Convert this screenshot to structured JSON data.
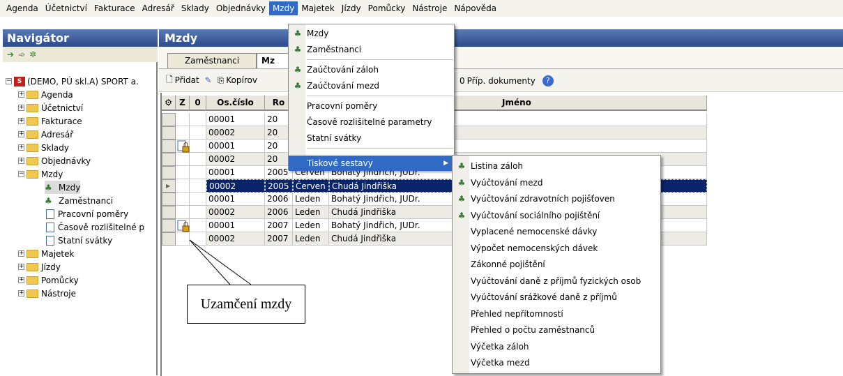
{
  "menubar": {
    "items": [
      "Agenda",
      "Účetnictví",
      "Fakturace",
      "Adresář",
      "Sklady",
      "Objednávky",
      "Mzdy",
      "Majetek",
      "Jízdy",
      "Pomůcky",
      "Nástroje",
      "Nápověda"
    ],
    "active": "Mzdy"
  },
  "navigator": {
    "title": "Navigátor",
    "tree": {
      "root": "(DEMO, PÚ skl.A) SPORT a.",
      "folders": [
        "Agenda",
        "Účetnictví",
        "Fakturace",
        "Adresář",
        "Sklady",
        "Objednávky",
        "Mzdy"
      ],
      "mzdy_children": [
        "Mzdy",
        "Zaměstnanci",
        "Pracovní poměry",
        "Časově rozlišitelné p",
        "Statní svátky"
      ],
      "after": [
        "Majetek",
        "Jízdy",
        "Pomůcky",
        "Nástroje"
      ]
    }
  },
  "main": {
    "title": "Mzdy",
    "tabs": [
      "Zaměstnanci",
      "Mz"
    ],
    "toolbar": {
      "add": "Přidat",
      "copy": "Kopírov",
      "attachments": "Příp. dokumenty"
    }
  },
  "grid": {
    "headers": {
      "z": "Z",
      "att": "0",
      "os": "Os.číslo",
      "ro": "Ro",
      "jmeno": "Jméno"
    },
    "rows": [
      {
        "os": "00001",
        "year": "20",
        "month": "",
        "name": ""
      },
      {
        "os": "00002",
        "year": "20",
        "month": "",
        "name": ""
      },
      {
        "os": "00001",
        "year": "20",
        "month": "",
        "name": ""
      },
      {
        "os": "00002",
        "year": "20",
        "month": "",
        "name": ""
      },
      {
        "os": "00001",
        "year": "2005",
        "month": "Červen",
        "name": "Bohatý Jindřich, JUDr."
      },
      {
        "os": "00002",
        "year": "2005",
        "month": "Červen",
        "name": "Chudá Jindřiška"
      },
      {
        "os": "00001",
        "year": "2006",
        "month": "Leden",
        "name": "Bohatý Jindřich, JUDr."
      },
      {
        "os": "00002",
        "year": "2006",
        "month": "Leden",
        "name": "Chudá Jindřiška"
      },
      {
        "os": "00001",
        "year": "2007",
        "month": "Leden",
        "name": "Bohatý Jindřich, JUDr."
      },
      {
        "os": "00002",
        "year": "2007",
        "month": "Leden",
        "name": "Chudá Jindřiška"
      }
    ]
  },
  "mzdy_menu": {
    "items": [
      "Mzdy",
      "Zaměstnanci",
      "Zaúčtování záloh",
      "Zaúčtování mezd",
      "Pracovní poměry",
      "Časově rozlišitelné parametry",
      "Statní svátky",
      "Tiskové sestavy"
    ]
  },
  "reports_menu": {
    "items": [
      "Listina záloh",
      "Vyúčtování mezd",
      "Vyúčtování zdravotních pojišťoven",
      "Vyúčtování sociálního pojištění",
      "Vyplacené nemocenské dávky",
      "Výpočet nemocenských dávek",
      "Zákonné pojištění",
      "Vyúčtování daně z příjmů fyzických osob",
      "Vyúčtování srážkové daně z příjmů",
      "Přehled nepřítomností",
      "Přehled o počtu zaměstnanců",
      "Výčetka záloh",
      "Výčetka mezd"
    ]
  },
  "callout": {
    "text": "Uzamčení mzdy"
  },
  "colors": {
    "selection": "#316ac5",
    "header_blue": "#2d4a8a",
    "selected_row": "#0a246a"
  }
}
